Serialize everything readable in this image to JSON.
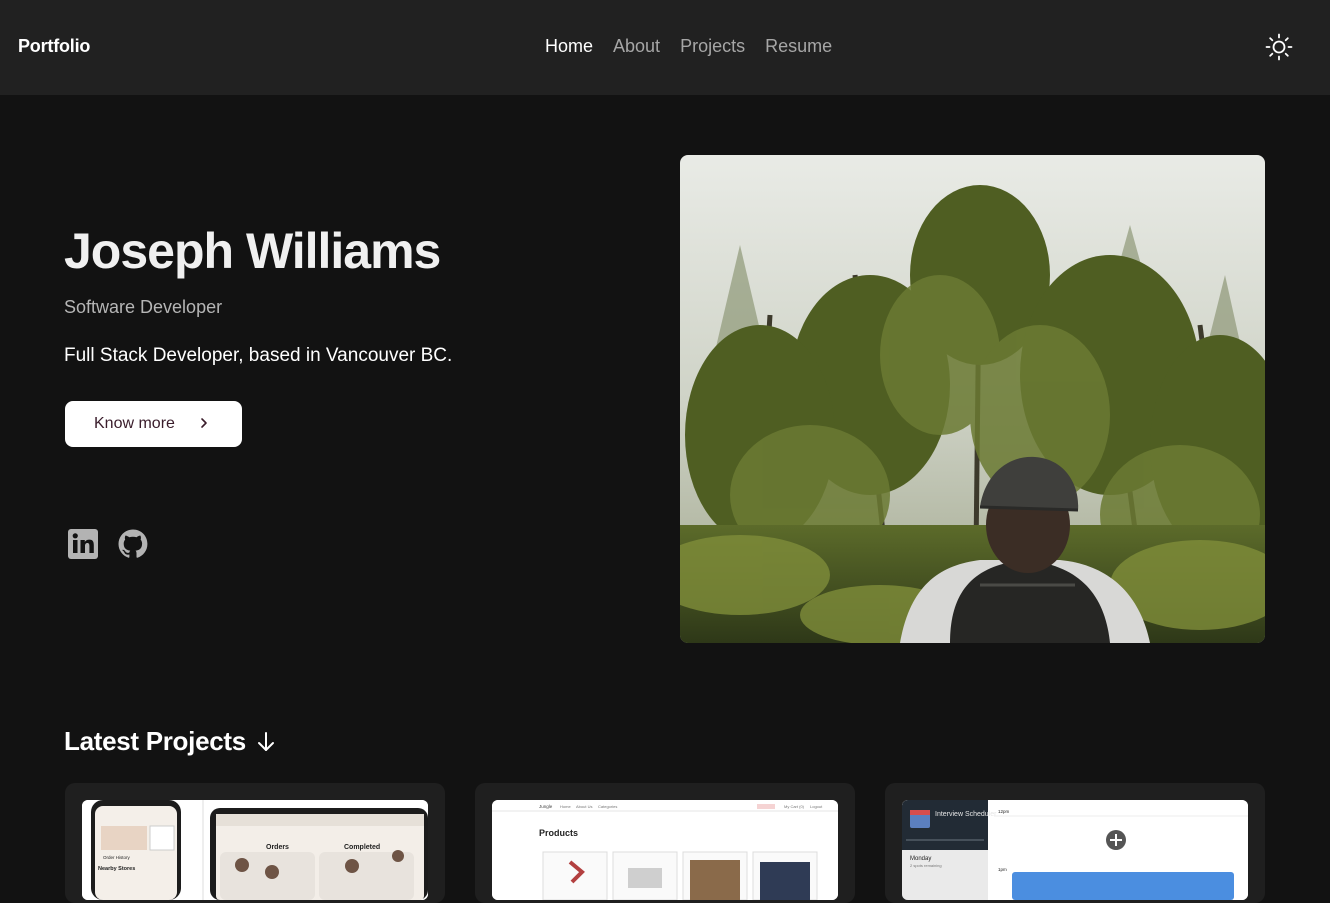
{
  "nav": {
    "brand": "Portfolio",
    "links": [
      {
        "label": "Home",
        "active": true
      },
      {
        "label": "About",
        "active": false
      },
      {
        "label": "Projects",
        "active": false
      },
      {
        "label": "Resume",
        "active": false
      }
    ],
    "theme_icon": "sun-icon"
  },
  "hero": {
    "name": "Joseph Williams",
    "title": "Software Developer",
    "description": "Full Stack Developer, based in Vancouver BC.",
    "cta_label": "Know more",
    "socials": [
      "linkedin-icon",
      "github-icon"
    ]
  },
  "projects": {
    "heading": "Latest Projects",
    "cards": [
      {
        "thumb_texts": {
          "orders": "Orders",
          "completed": "Completed",
          "nearby": "Nearby Stores",
          "order_history": "Order History"
        }
      },
      {
        "thumb_texts": {
          "brand": "Jungle",
          "products": "Products",
          "home": "Home",
          "about": "About Us",
          "categories": "Categories",
          "cart": "My Cart (0)",
          "logout": "Logout"
        }
      },
      {
        "thumb_texts": {
          "app": "Interview Scheduler",
          "day": "Monday",
          "spots": "2 spots remaining",
          "time1": "12pm",
          "time2": "1pm"
        }
      }
    ]
  },
  "colors": {
    "background": "#121212",
    "navbar": "#212121",
    "card": "#1f1f1f",
    "muted": "#a6a6a6"
  }
}
